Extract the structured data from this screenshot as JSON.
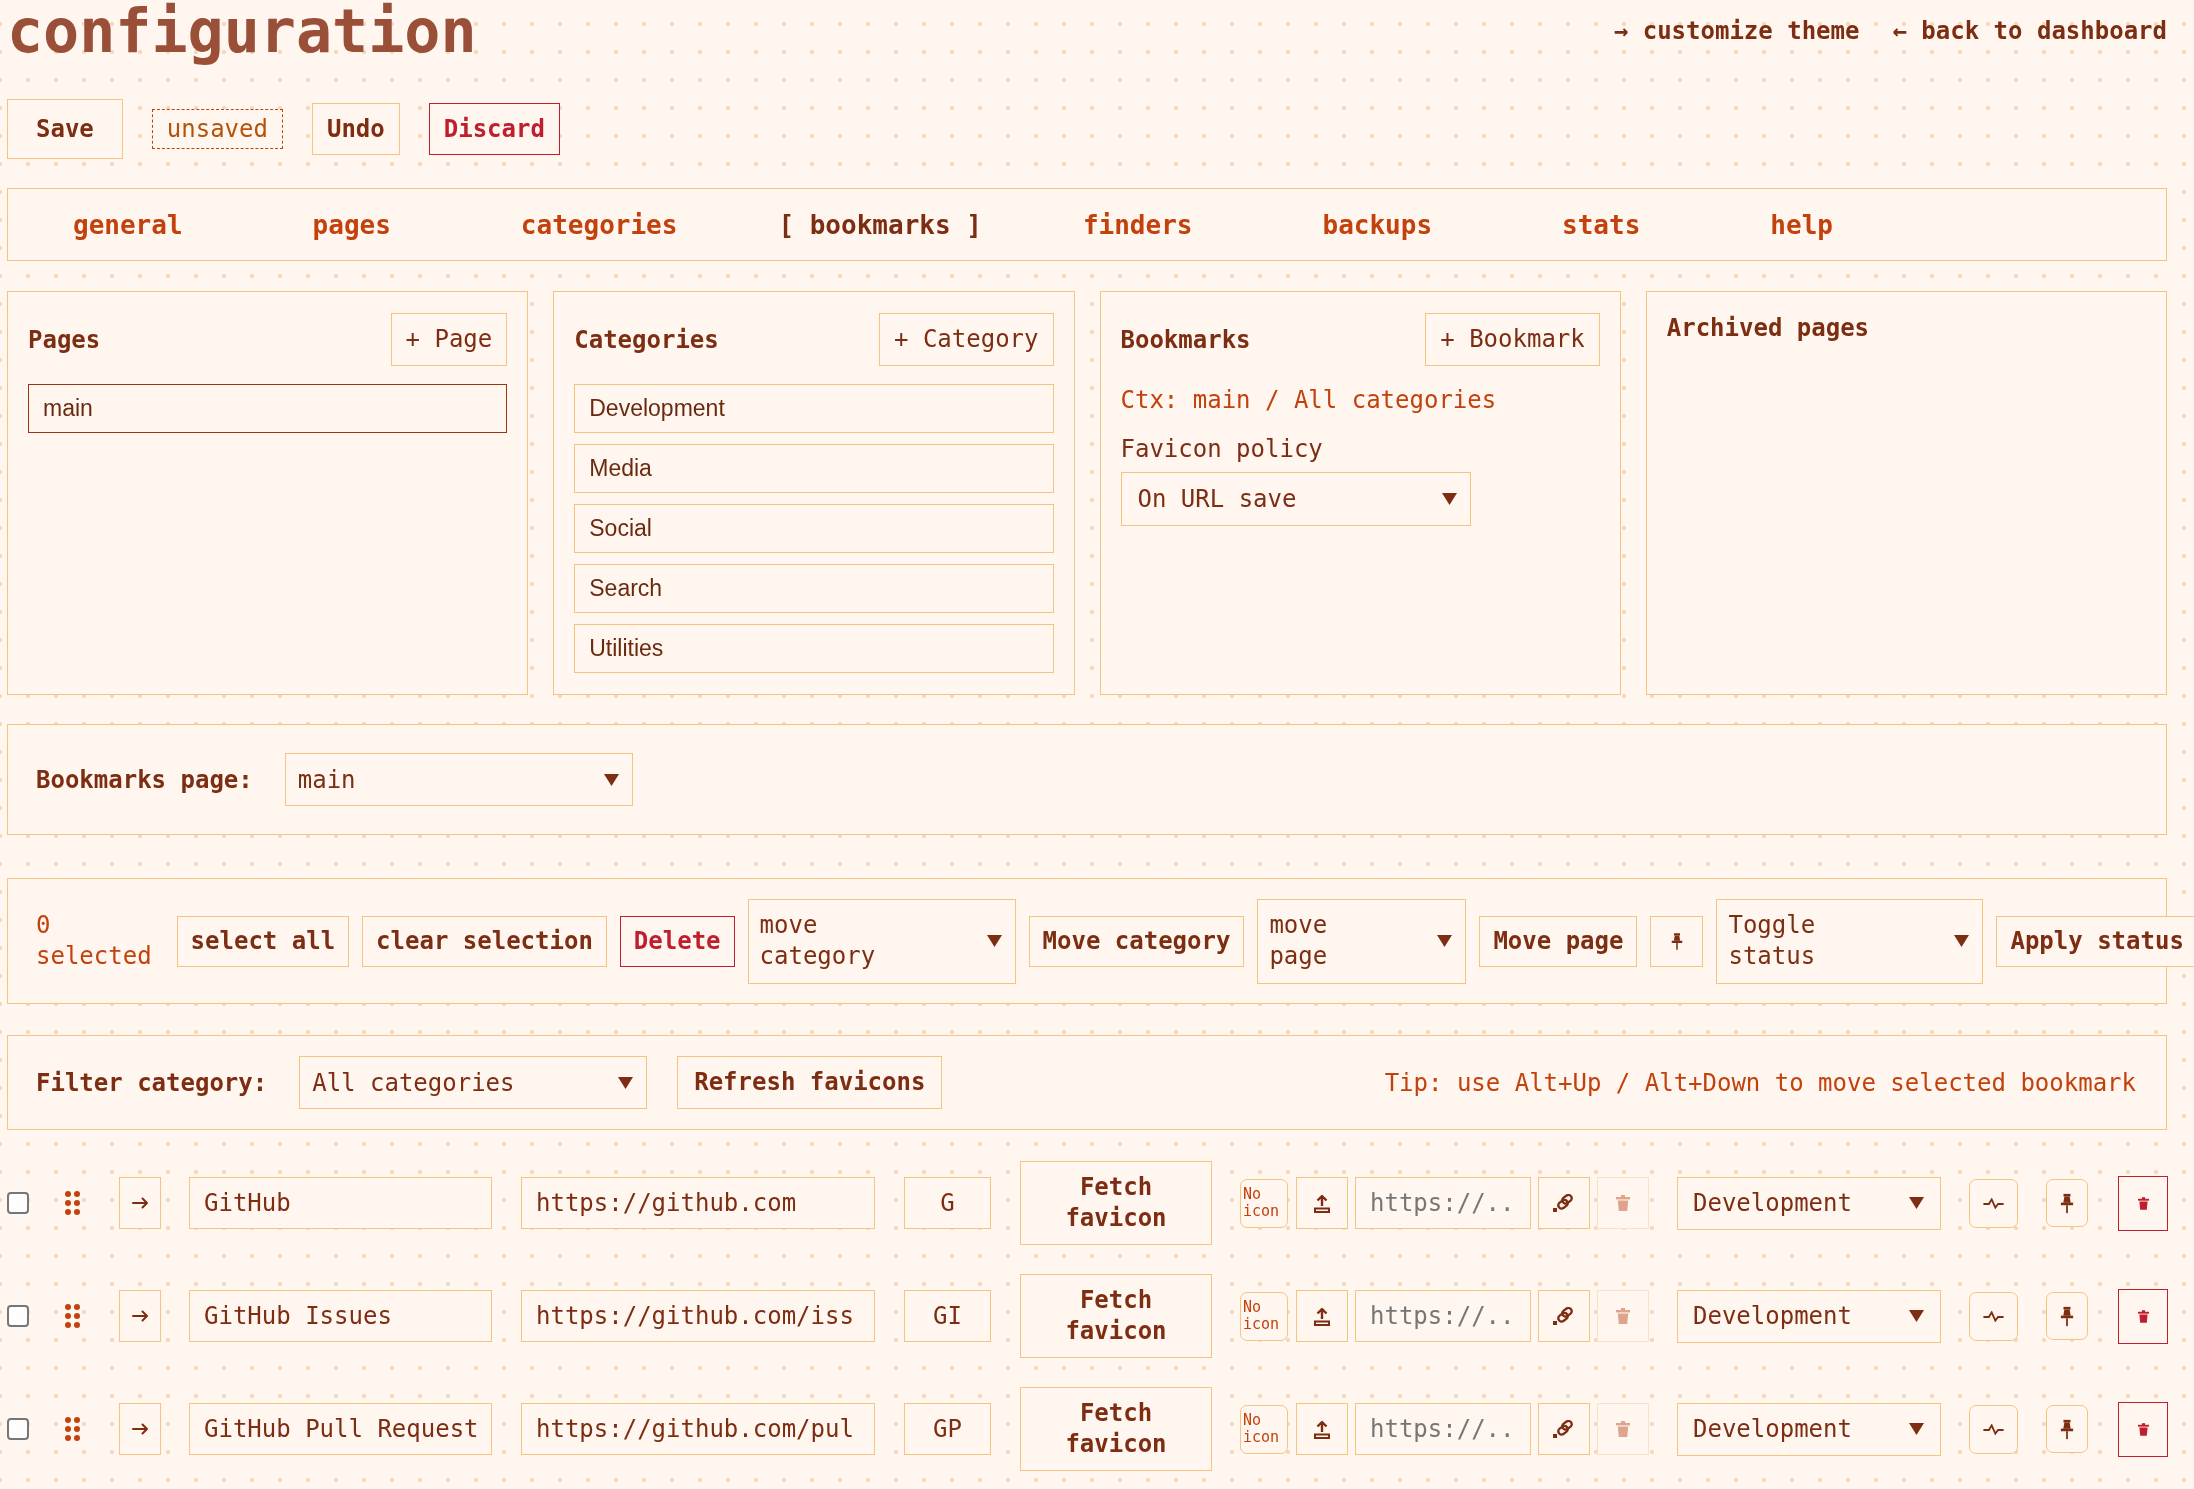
{
  "header": {
    "title": "configuration",
    "links": [
      "→ customize theme",
      "← back to dashboard"
    ]
  },
  "actions": {
    "save": "Save",
    "state": "unsaved",
    "undo": "Undo",
    "discard": "Discard"
  },
  "tabs": [
    {
      "label": "general",
      "selected": false
    },
    {
      "label": "pages",
      "selected": false
    },
    {
      "label": "categories",
      "selected": false
    },
    {
      "label": "[ bookmarks ]",
      "selected": true
    },
    {
      "label": "finders",
      "selected": false
    },
    {
      "label": "backups",
      "selected": false
    },
    {
      "label": "stats",
      "selected": false
    },
    {
      "label": "help",
      "selected": false
    }
  ],
  "panels": [
    {
      "kind": "list",
      "title": "Pages",
      "add_button": "+ Page",
      "items": [
        {
          "name": "main",
          "selected": true
        }
      ]
    },
    {
      "kind": "list",
      "title": "Categories",
      "add_button": "+ Category",
      "items": [
        {
          "name": "Development",
          "selected": false
        },
        {
          "name": "Media",
          "selected": false
        },
        {
          "name": "Social",
          "selected": false
        },
        {
          "name": "Search",
          "selected": false
        },
        {
          "name": "Utilities",
          "selected": false
        }
      ]
    },
    {
      "kind": "bookmarks",
      "title": "Bookmarks",
      "add_button": "+ Bookmark",
      "context": "Ctx: main / All categories",
      "favicon_policy": {
        "label": "Favicon policy",
        "value": "On URL save"
      }
    },
    {
      "kind": "archive",
      "title": "Archived pages"
    }
  ],
  "page_picker": {
    "label": "Bookmarks page:",
    "value": "main"
  },
  "bulk_bar": [
    {
      "kind": "count",
      "text": "0 selected"
    },
    {
      "kind": "button",
      "label": "select all"
    },
    {
      "kind": "button",
      "label": "clear selection"
    },
    {
      "kind": "danger",
      "label": "Delete"
    },
    {
      "kind": "dropdown",
      "value": "move category"
    },
    {
      "kind": "button",
      "label": "Move category"
    },
    {
      "kind": "dropdown",
      "value": "move page"
    },
    {
      "kind": "button",
      "label": "Move page"
    },
    {
      "kind": "pin"
    },
    {
      "kind": "dropdown",
      "value": "Toggle status"
    },
    {
      "kind": "button",
      "label": "Apply status"
    }
  ],
  "filter_bar": {
    "label": "Filter category:",
    "value": "All categories",
    "refresh": "Refresh favicons",
    "tip": "Tip: use Alt+Up / Alt+Down to move selected bookmark"
  },
  "bookmarks": [
    {
      "checked": false,
      "name": "GitHub",
      "url": "https://github.com",
      "short": "G",
      "fetch": "Fetch favicon",
      "icon_status": "No icon",
      "favicon_placeholder": "https://..",
      "icon_remove_disabled": true,
      "category": "Development"
    },
    {
      "checked": false,
      "name": "GitHub Issues",
      "url": "https://github.com/iss",
      "short": "GI",
      "fetch": "Fetch favicon",
      "icon_status": "No icon",
      "favicon_placeholder": "https://..",
      "icon_remove_disabled": true,
      "category": "Development"
    },
    {
      "checked": false,
      "name": "GitHub Pull Request",
      "url": "https://github.com/pul",
      "short": "GP",
      "fetch": "Fetch favicon",
      "icon_status": "No icon",
      "favicon_placeholder": "https://..",
      "icon_remove_disabled": true,
      "category": "Development"
    }
  ]
}
